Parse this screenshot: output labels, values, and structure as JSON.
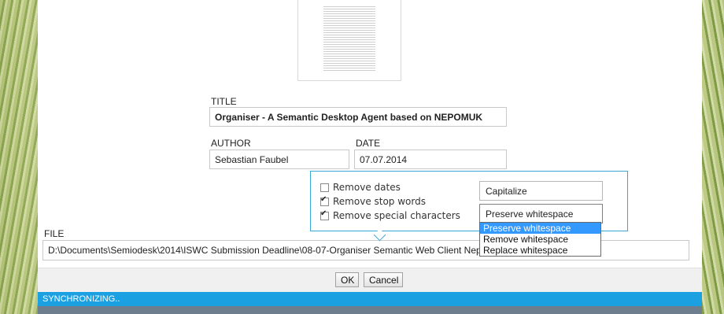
{
  "form": {
    "title_label": "TITLE",
    "title_value": "Organiser - A Semantic Desktop Agent based on NEPOMUK",
    "author_label": "AUTHOR",
    "author_value": "Sebastian Faubel",
    "date_label": "DATE",
    "date_value": "07.07.2014",
    "file_label": "FILE",
    "file_value": "D:\\Documents\\Semiodesk\\2014\\ISWC Submission Deadline\\08-07-Organiser Semantic Web Client Nepomuk"
  },
  "options": {
    "remove_dates": {
      "label": "Remove dates",
      "checked": false
    },
    "remove_stop_words": {
      "label": "Remove stop words",
      "checked": true
    },
    "remove_special_characters": {
      "label": "Remove special characters",
      "checked": true
    },
    "capitalize_label": "Capitalize",
    "whitespace_selected": "Preserve whitespace",
    "whitespace_options": [
      "Preserve whitespace",
      "Remove whitespace",
      "Replace whitespace"
    ]
  },
  "buttons": {
    "ok": "OK",
    "cancel": "Cancel"
  },
  "status": {
    "text": "SYNCHRONIZING.."
  },
  "colors": {
    "accent": "#1ba1e2",
    "selection": "#3399ff",
    "popup_border": "#3aa6d5"
  }
}
